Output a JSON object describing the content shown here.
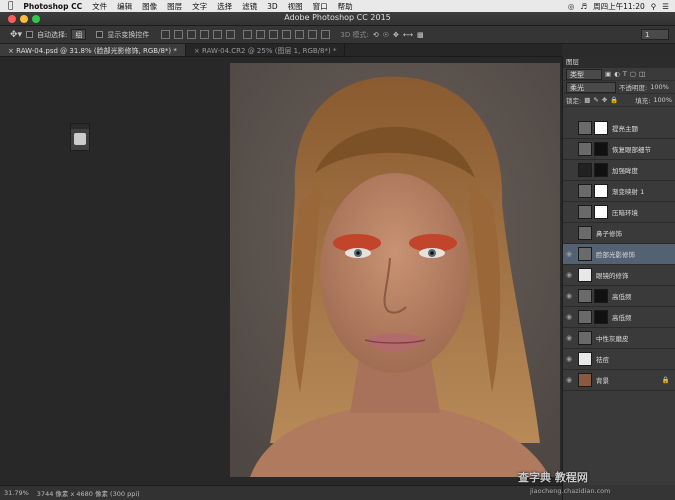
{
  "menubar": {
    "app": "Photoshop CC",
    "items": [
      "文件",
      "编辑",
      "图像",
      "图层",
      "文字",
      "选择",
      "滤镜",
      "3D",
      "视图",
      "窗口",
      "帮助"
    ],
    "clock": "周四上午11:20"
  },
  "window": {
    "title": "Adobe Photoshop CC 2015"
  },
  "options": {
    "auto_select_label": "自动选择:",
    "auto_select_value": "组",
    "show_transform_label": "显示变换控件",
    "mode3d_label": "3D 模式:",
    "workspace_value": "1"
  },
  "tabs": [
    {
      "label": "RAW-04.psd @ 31.8% (脸部光影修饰, RGB/8*) *"
    },
    {
      "label": "RAW-04.CR2 @ 25% (图层 1, RGB/8*) *"
    }
  ],
  "status": {
    "zoom": "31.79%",
    "doc_size": "3744 像素 x 4680 像素 (300 ppi)"
  },
  "layers_panel": {
    "title": "图层",
    "filter_value": "类型",
    "blend_mode": "柔光",
    "opacity_label": "不透明度:",
    "opacity_value": "100%",
    "lock_label": "锁定:",
    "fill_label": "填充:",
    "fill_value": "100%",
    "layers": [
      {
        "name": "提亮主题",
        "visible": false,
        "selected": false
      },
      {
        "name": "恢复眼部细节",
        "visible": false,
        "selected": false
      },
      {
        "name": "加强眸度",
        "visible": false,
        "selected": false
      },
      {
        "name": "渐变映射 1",
        "visible": false,
        "selected": false
      },
      {
        "name": "压暗环境",
        "visible": false,
        "selected": false
      },
      {
        "name": "鼻子修饰",
        "visible": false,
        "selected": false
      },
      {
        "name": "脸部光影修饰",
        "visible": true,
        "selected": true
      },
      {
        "name": "眼镜的修饰",
        "visible": true,
        "selected": false
      },
      {
        "name": "高低频",
        "visible": true,
        "selected": false
      },
      {
        "name": "高低频",
        "visible": true,
        "selected": false
      },
      {
        "name": "中性灰磨皮",
        "visible": true,
        "selected": false
      },
      {
        "name": "祛痘",
        "visible": true,
        "selected": false
      },
      {
        "name": "背景",
        "visible": true,
        "selected": false
      }
    ]
  },
  "watermark": {
    "text": "查字典 教程网",
    "url": "jiaocheng.chazidian.com"
  }
}
